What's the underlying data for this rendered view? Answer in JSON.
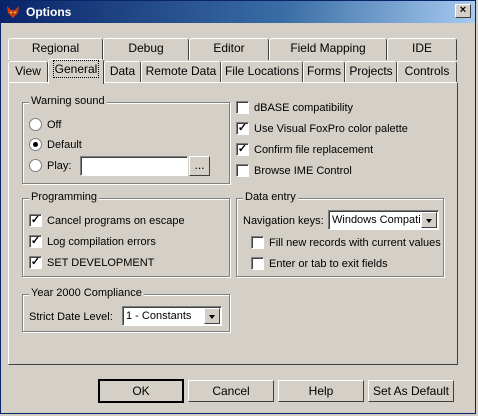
{
  "window": {
    "title": "Options",
    "close_glyph": "×"
  },
  "tabs_row1": [
    "Regional",
    "Debug",
    "Editor",
    "Field Mapping",
    "IDE"
  ],
  "tabs_row2": [
    "View",
    "General",
    "Data",
    "Remote Data",
    "File Locations",
    "Forms",
    "Projects",
    "Controls"
  ],
  "selected_tab": "General",
  "warning_sound": {
    "title": "Warning sound",
    "off": "Off",
    "default": "Default",
    "play": "Play:",
    "play_value": "",
    "browse": "..."
  },
  "compat": {
    "dbase": "dBASE compatibility",
    "vfp_palette": "Use Visual FoxPro color palette",
    "confirm_replace": "Confirm file replacement",
    "browse_ime": "Browse IME Control"
  },
  "programming": {
    "title": "Programming",
    "cancel_on_escape": "Cancel programs on escape",
    "log_errors": "Log compilation errors",
    "set_development": "SET DEVELOPMENT"
  },
  "data_entry": {
    "title": "Data entry",
    "nav_label": "Navigation keys:",
    "nav_value": "Windows Compatit",
    "fill_new_records": "Fill new records with current values",
    "enter_tab_exit": "Enter or tab to exit fields"
  },
  "y2k": {
    "title": "Year 2000 Compliance",
    "strict_label": "Strict Date Level:",
    "strict_value": "1 - Constants"
  },
  "buttons": {
    "ok": "OK",
    "cancel": "Cancel",
    "help": "Help",
    "default": "Set As Default"
  },
  "check_glyph": "✓"
}
